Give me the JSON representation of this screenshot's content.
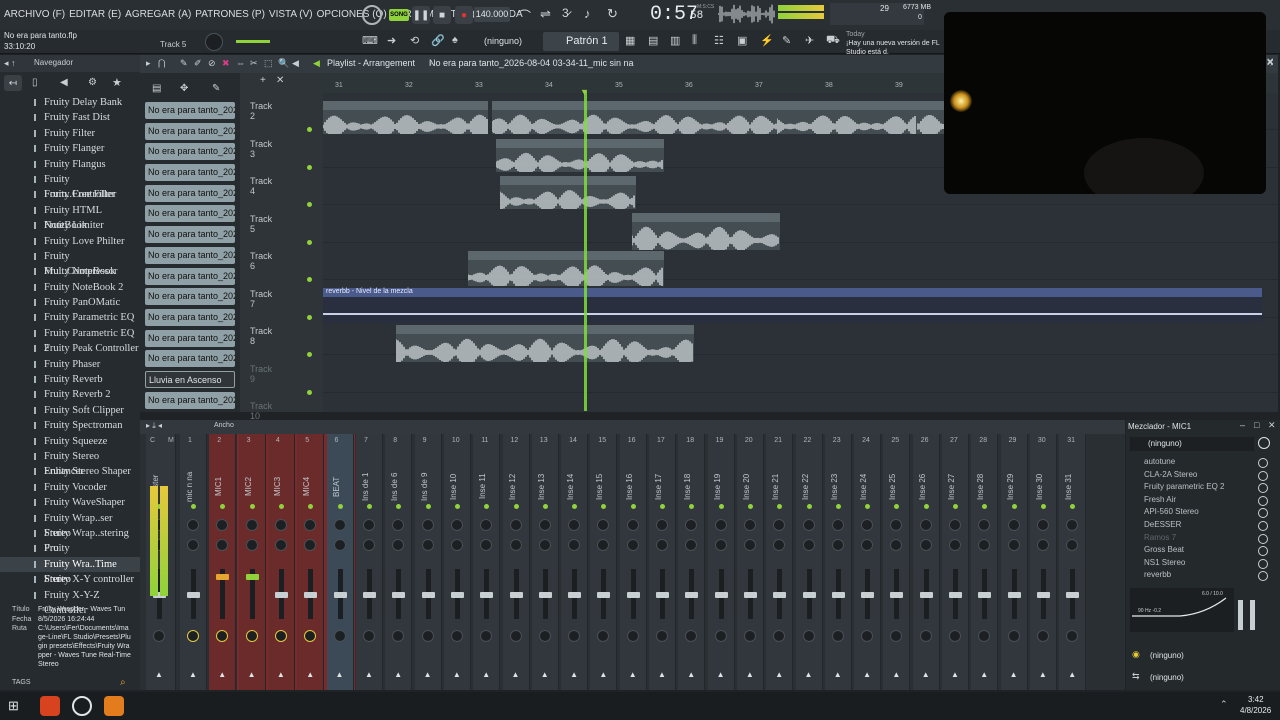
{
  "menu": {
    "items": [
      "ARCHIVO (F)",
      "EDITAR (E)",
      "AGREGAR (A)",
      "PATRONES (P)",
      "VISTA (V)",
      "OPCIONES (O)",
      "HERRAMIENTAS (T)",
      "AYUDA"
    ]
  },
  "transport": {
    "song_badge": "SONG",
    "tempo": "140.000",
    "time": "0:57",
    "time_small": "58",
    "misc_label": "M:S:CS",
    "cpu_label": "29",
    "mem_label": "6773 MB",
    "mem_sub": "0"
  },
  "project": {
    "file": "No era para tanto.flp",
    "time": "33:10:20",
    "hint": "Track 5"
  },
  "toolbar2": {
    "snap": "(ninguno)",
    "pattern": "Patrón 1",
    "news_today": "Today",
    "news_text": "¡Hay una nueva versión de FL Studio está d."
  },
  "browser": {
    "title": "Navegador",
    "items": [
      "Fruity Delay Bank",
      "Fruity Fast Dist",
      "Fruity Filter",
      "Fruity Flanger",
      "Fruity Flangus",
      "Fruity Form..Controller",
      "Fruity Free Filter",
      "Fruity HTML NoteBook",
      "Fruity Limiter",
      "Fruity Love Philter",
      "Fruity Mul..Compressor",
      "Fruity NoteBook",
      "Fruity NoteBook 2",
      "Fruity PanOMatic",
      "Fruity Parametric EQ",
      "Fruity Parametric EQ 2",
      "Fruity Peak Controller",
      "Fruity Phaser",
      "Fruity Reverb",
      "Fruity Reverb 2",
      "Fruity Soft Clipper",
      "Fruity Spectroman",
      "Fruity Squeeze",
      "Fruity Stereo Enhancer",
      "Fruity Stereo Shaper",
      "Fruity Vocoder",
      "Fruity WaveShaper",
      "Fruity Wrap..ser Stereo",
      "Fruity Wrap..stering Pro",
      "Fruity Wra..VintageVerb",
      "Fruity Wra..Time Stereo",
      "Fruity X-Y controller",
      "Fruity X-Y-Z Controller"
    ],
    "selected": "Fruity Wra..Time Stereo",
    "info": {
      "title_label": "Título",
      "title": "Fruity Wrapper - Waves Tun",
      "date_label": "Fecha",
      "date": "8/5/2026 16:24:44",
      "path_label": "Ruta",
      "path": "C:\\Users\\Fer\\Documents\\Image-Line\\FL Studio\\Presets\\Plugin presets\\Effects\\Fruity Wrapper - Waves Tune Real-Time Stereo"
    },
    "tags": "TAGS"
  },
  "playlist": {
    "title": "Playlist - Arrangement",
    "breadcrumb": "No era para tanto_2026-08-04 03-34-11_mic sin na",
    "ruler": [
      "31",
      "32",
      "33",
      "34",
      "35",
      "36",
      "37",
      "38",
      "39"
    ],
    "channels": [
      "No era para tanto_2026-",
      "No era para tanto_2026-",
      "No era para tanto_2026-",
      "No era para tanto_2026-",
      "No era para tanto_2026-",
      "No era para tanto_2026-",
      "No era para tanto_2026-",
      "No era para tanto_2026-",
      "No era para tanto_2026-",
      "No era para tanto_2026-",
      "No era para tanto_2026-",
      "No era para tanto_2026-",
      "No era para tanto_2026-",
      "Lluvia en Ascenso",
      "No era para tanto_2026-"
    ],
    "tracks": [
      "Track 2",
      "Track 3",
      "Track 4",
      "Track 5",
      "Track 6",
      "Track 7",
      "Track 8",
      "Track 9",
      "Track 10"
    ],
    "clips": {
      "t2a": "No era para tanto_2026-08-04 03-34-11_mic sin na",
      "t2b": "No era para tanto_20_03-34-11_mic sin na",
      "t2c": "No era para tanto_20_03-34-11_mic sin na",
      "t2d": "No era para tanto_20_03-34-11_mic sin na",
      "t3": "No era para tanto_2026-08-04 03-37-46_mic sin na",
      "t4": "No era para tanto_20_3-38-22_mic sin na",
      "t5": "No era para tanto_202_4 03-38-44_mic sin na",
      "t6": "No era para tanto_2026-08-04 03-39-59_mic sin na",
      "t7": "reverbb - Nivel de la mezcla",
      "t8": "No era para tanto_2026-08-04 03-41-59_mic sin na"
    }
  },
  "mixer": {
    "view": "Ancho",
    "strips": [
      "Master",
      "mic n na",
      "MIC1",
      "MIC2",
      "MIC3",
      "MIC4",
      "BEAT",
      "Ins de 1",
      "Ins de 6",
      "Ins de 9",
      "Inse 10",
      "Inse 11",
      "Inse 12",
      "Inse 13",
      "Inse 14",
      "Inse 15",
      "Inse 16",
      "Inse 17",
      "Inse 18",
      "Inse 19",
      "Inse 20",
      "Inse 21",
      "Inse 22",
      "Inse 23",
      "Inse 24",
      "Inse 25",
      "Inse 26",
      "Inse 27",
      "Inse 28",
      "Inse 29",
      "Inse 30",
      "Inse 31"
    ],
    "numbers": [
      "C",
      "M",
      "1",
      "2",
      "3",
      "4",
      "5",
      "6",
      "7",
      "8",
      "9",
      "10",
      "11",
      "12",
      "13",
      "14",
      "15",
      "16",
      "17",
      "18",
      "19",
      "20",
      "21",
      "22",
      "23",
      "24",
      "25",
      "26",
      "27",
      "28",
      "29",
      "30",
      "31"
    ]
  },
  "mixer_slots": {
    "title": "Mezclador - MIC1",
    "preset": "(ninguno)",
    "fx": [
      "autotune",
      "CLA-2A Stereo",
      "Fruity parametric EQ 2",
      "Fresh Air",
      "API-560 Stereo",
      "DeESSER",
      "Ramos 7",
      "Gross Beat",
      "NS1 Stereo",
      "reverbb"
    ],
    "eq_a": "90 Hz -0.2",
    "eq_b": "6.0 / 10.0",
    "out1": "(ninguno)",
    "out2": "(ninguno)"
  },
  "taskbar": {
    "time": "3:42",
    "date": "4/8/2026"
  },
  "colors": {
    "accent": "#8fd23a",
    "red_strips": "#8a2a2a",
    "playhead": "#7dde3a",
    "clip_header": "#5d686e",
    "automation": "#4a5a8a"
  }
}
